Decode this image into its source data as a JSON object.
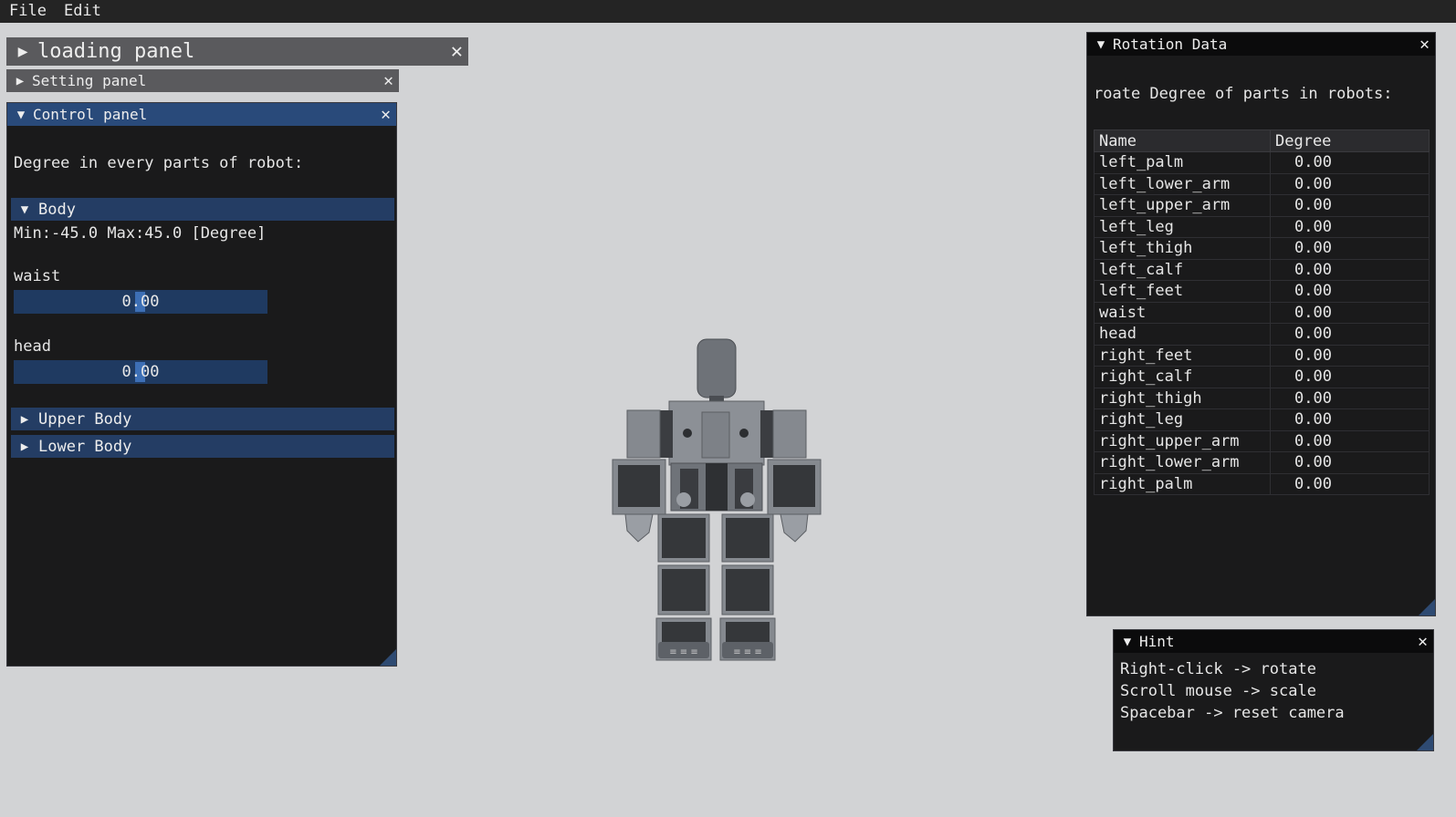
{
  "menubar": {
    "file": "File",
    "edit": "Edit"
  },
  "loading_panel": {
    "title": "loading panel"
  },
  "setting_panel": {
    "title": "Setting panel"
  },
  "control_panel": {
    "title": "Control panel",
    "description": "Degree in every parts of robot:",
    "body_section": "Body",
    "range_text": "Min:-45.0 Max:45.0 [Degree]",
    "waist_label": "waist",
    "waist_value": "0.00",
    "head_label": "head",
    "head_value": "0.00",
    "upper_body_section": "Upper Body",
    "lower_body_section": "Lower Body"
  },
  "rotation_panel": {
    "title": "Rotation Data",
    "description": "roate Degree of parts in robots:",
    "columns": [
      "Name",
      "Degree"
    ],
    "rows": [
      {
        "name": "left_palm",
        "degree": "0.00"
      },
      {
        "name": "left_lower_arm",
        "degree": "0.00"
      },
      {
        "name": "left_upper_arm",
        "degree": "0.00"
      },
      {
        "name": "left_leg",
        "degree": "0.00"
      },
      {
        "name": "left_thigh",
        "degree": "0.00"
      },
      {
        "name": "left_calf",
        "degree": "0.00"
      },
      {
        "name": "left_feet",
        "degree": "0.00"
      },
      {
        "name": "waist",
        "degree": "0.00"
      },
      {
        "name": "head",
        "degree": "0.00"
      },
      {
        "name": "right_feet",
        "degree": "0.00"
      },
      {
        "name": "right_calf",
        "degree": "0.00"
      },
      {
        "name": "right_thigh",
        "degree": "0.00"
      },
      {
        "name": "right_leg",
        "degree": "0.00"
      },
      {
        "name": "right_upper_arm",
        "degree": "0.00"
      },
      {
        "name": "right_lower_arm",
        "degree": "0.00"
      },
      {
        "name": "right_palm",
        "degree": "0.00"
      }
    ]
  },
  "hint_panel": {
    "title": "Hint",
    "lines": [
      "Right-click -> rotate",
      "Scroll mouse -> scale",
      "Spacebar -> reset camera"
    ]
  },
  "icons": {
    "expanded": "triangle-down-icon",
    "collapsed": "triangle-right-icon",
    "close": "close-icon"
  },
  "colors": {
    "background": "#d2d3d5",
    "panel": "#1a1a1b",
    "accent": "#294a7a",
    "slider": "#1f3a61"
  }
}
